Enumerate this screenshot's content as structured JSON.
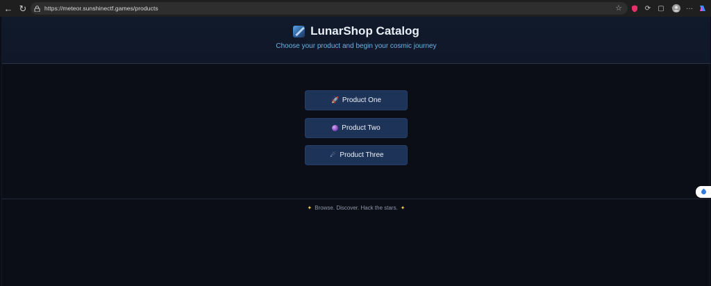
{
  "browser": {
    "url": "https://meteor.sunshinectf.games/products",
    "icons": [
      "back-icon",
      "reload-icon",
      "lock-icon",
      "star-icon",
      "shield-extension-icon",
      "extension-icon",
      "collections-icon",
      "favorites-icon",
      "profile-avatar",
      "more-icon",
      "copilot-icon"
    ]
  },
  "header": {
    "title": "LunarShop Catalog",
    "subtitle": "Choose your product and begin your cosmic journey"
  },
  "products": [
    {
      "label": "Product One",
      "icon": "rocket-icon"
    },
    {
      "label": "Product Two",
      "icon": "planet-icon"
    },
    {
      "label": "Product Three",
      "icon": "comet-icon"
    }
  ],
  "footer": {
    "text": "Browse. Discover. Hack the stars."
  },
  "colors": {
    "background": "#0b0e17",
    "header_bg": "#111a2b",
    "button_bg": "#1d3357",
    "subtitle": "#6cb4e8"
  }
}
